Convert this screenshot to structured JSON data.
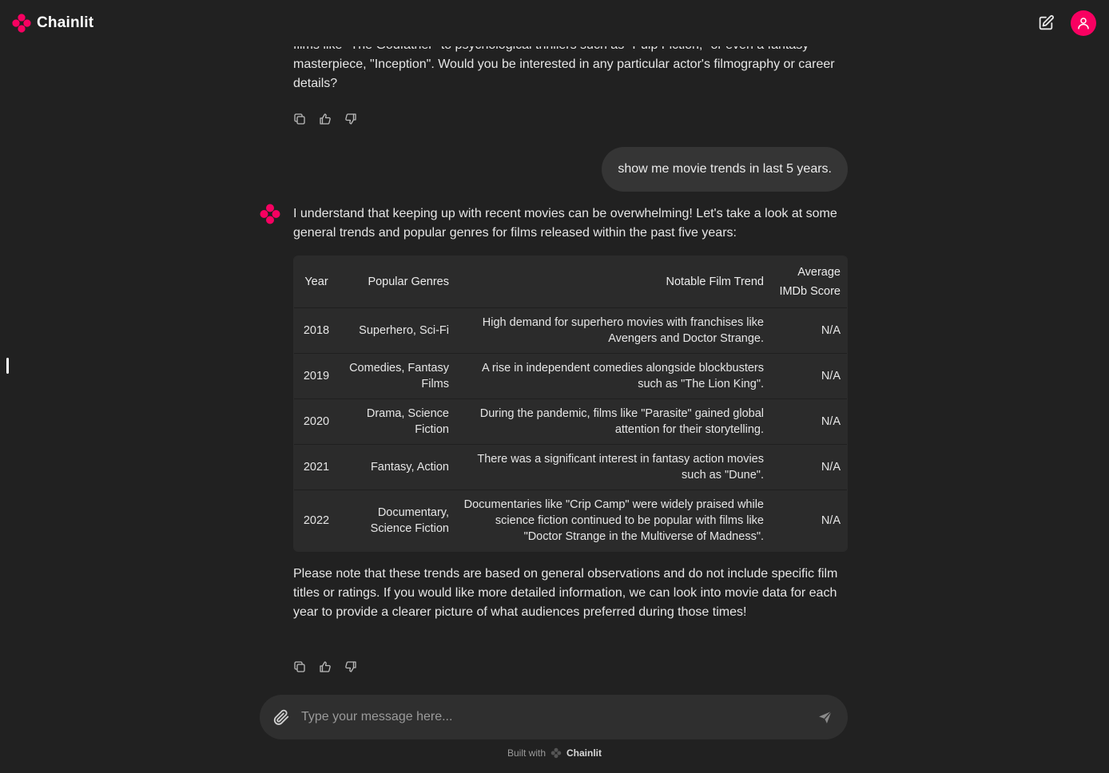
{
  "header": {
    "app_name": "Chainlit",
    "new_chat_icon": "pencil-square-icon",
    "user_icon": "user-icon"
  },
  "conversation": {
    "prev_message_partial": "films like \"The Godfather\" to psychological thrillers such as \"Pulp Fiction,\" or even a fantasy masterpiece, \"Inception\". Would you be interested in any particular actor's filmography or career details?",
    "user_message": "show me movie trends in last 5 years.",
    "bot_intro": "I understand that keeping up with recent movies can be overwhelming! Let's take a look at some general trends and popular genres for films released within the past five years:",
    "table": {
      "headers": [
        "Year",
        "Popular Genres",
        "Notable Film Trend",
        "Average IMDb Score"
      ],
      "rows": [
        [
          "2018",
          "Superhero, Sci-Fi",
          "High demand for superhero movies with franchises like Avengers and Doctor Strange.",
          "N/A"
        ],
        [
          "2019",
          "Comedies, Fantasy Films",
          "A rise in independent comedies alongside blockbusters such as \"The Lion King\".",
          "N/A"
        ],
        [
          "2020",
          "Drama, Science Fiction",
          "During the pandemic, films like \"Parasite\" gained global attention for their storytelling.",
          "N/A"
        ],
        [
          "2021",
          "Fantasy, Action",
          "There was a significant interest in fantasy action movies such as \"Dune\".",
          "N/A"
        ],
        [
          "2022",
          "Documentary, Science Fiction",
          "Documentaries like \"Crip Camp\" were widely praised while science fiction continued to be popular with films like \"Doctor Strange in the Multiverse of Madness\".",
          "N/A"
        ]
      ]
    },
    "bot_outro": "Please note that these trends are based on general observations and do not include specific film titles or ratings. If you would like more detailed information, we can look into movie data for each year to provide a clearer picture of what audiences preferred during those times!",
    "message_actions": [
      "copy-icon",
      "thumbs-up-icon",
      "thumbs-down-icon"
    ]
  },
  "composer": {
    "placeholder": "Type your message here...",
    "attach_icon": "paperclip-icon",
    "send_icon": "send-icon"
  },
  "footer": {
    "built_with": "Built with",
    "brand": "Chainlit"
  },
  "colors": {
    "background": "#212121",
    "accent": "#f80061",
    "bubble": "#353535",
    "table_bg": "#2b2b2b"
  }
}
